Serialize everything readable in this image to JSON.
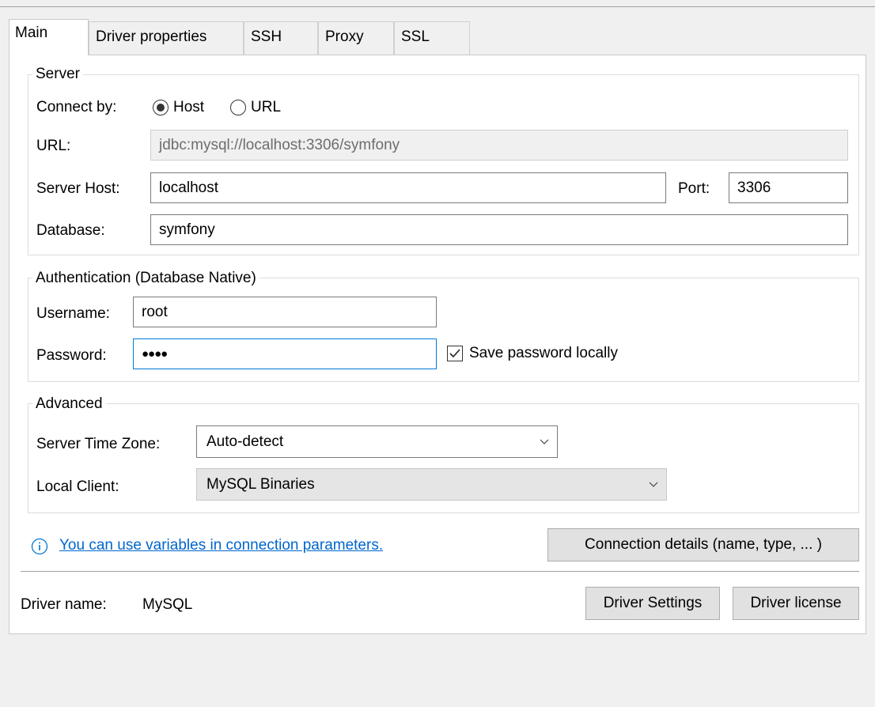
{
  "tabs": [
    {
      "label": "Main",
      "active": true
    },
    {
      "label": "Driver properties",
      "active": false
    },
    {
      "label": "SSH",
      "active": false
    },
    {
      "label": "Proxy",
      "active": false
    },
    {
      "label": "SSL",
      "active": false
    }
  ],
  "server": {
    "legend": "Server",
    "connect_by_label": "Connect by:",
    "option_host": "Host",
    "option_url": "URL",
    "selected": "Host",
    "url_label": "URL:",
    "url_value": "jdbc:mysql://localhost:3306/symfony",
    "host_label": "Server Host:",
    "host_value": "localhost",
    "port_label": "Port:",
    "port_value": "3306",
    "database_label": "Database:",
    "database_value": "symfony"
  },
  "auth": {
    "legend": "Authentication (Database Native)",
    "username_label": "Username:",
    "username_value": "root",
    "password_label": "Password:",
    "password_value": "●●●●",
    "save_password_label": "Save password locally",
    "save_password_checked": true
  },
  "advanced": {
    "legend": "Advanced",
    "timezone_label": "Server Time Zone:",
    "timezone_value": "Auto-detect",
    "local_client_label": "Local Client:",
    "local_client_value": "MySQL Binaries"
  },
  "info": {
    "icon": "info-icon",
    "link_text": "You can use variables in connection parameters."
  },
  "buttons": {
    "connection_details": "Connection details (name, type, ... )",
    "driver_settings": "Driver Settings",
    "driver_license": "Driver license"
  },
  "driver": {
    "name_label": "Driver name:",
    "name_value": "MySQL"
  },
  "colors": {
    "link": "#0066cc",
    "focus": "#0078d7",
    "info_icon": "#0078d7"
  }
}
